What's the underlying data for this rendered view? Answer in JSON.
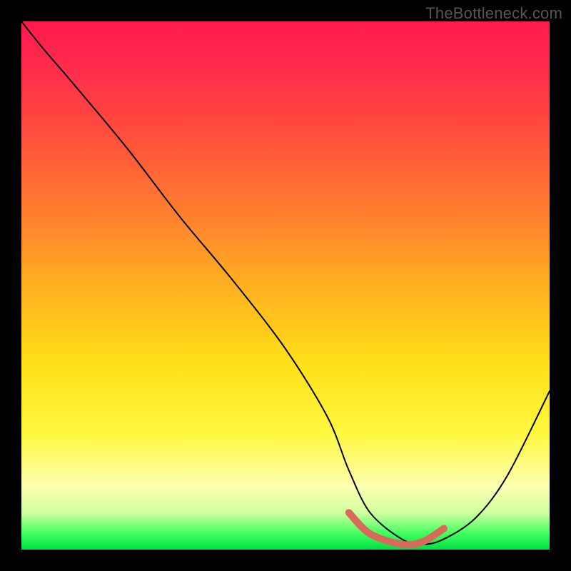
{
  "watermark": "TheBottleneck.com",
  "chart_data": {
    "type": "line",
    "title": "",
    "xlabel": "",
    "ylabel": "",
    "xlim": [
      0,
      100
    ],
    "ylim": [
      0,
      100
    ],
    "series": [
      {
        "name": "bottleneck-curve",
        "type": "line",
        "x": [
          0,
          4,
          10,
          20,
          30,
          40,
          50,
          58,
          62,
          66,
          72,
          76,
          80,
          86,
          92,
          100
        ],
        "y": [
          100,
          95,
          88,
          76,
          63,
          51,
          38,
          25,
          15,
          7,
          2,
          1,
          2,
          6,
          14,
          30
        ]
      },
      {
        "name": "optimal-highlight",
        "type": "line",
        "x": [
          62,
          66,
          72,
          76,
          80
        ],
        "y": [
          7,
          3,
          1,
          1.5,
          4
        ]
      }
    ],
    "gradient_stops": [
      {
        "pos": 0.0,
        "color": "#ff1a4d"
      },
      {
        "pos": 0.5,
        "color": "#ffe018"
      },
      {
        "pos": 0.95,
        "color": "#40ff60"
      },
      {
        "pos": 1.0,
        "color": "#00e040"
      }
    ]
  }
}
